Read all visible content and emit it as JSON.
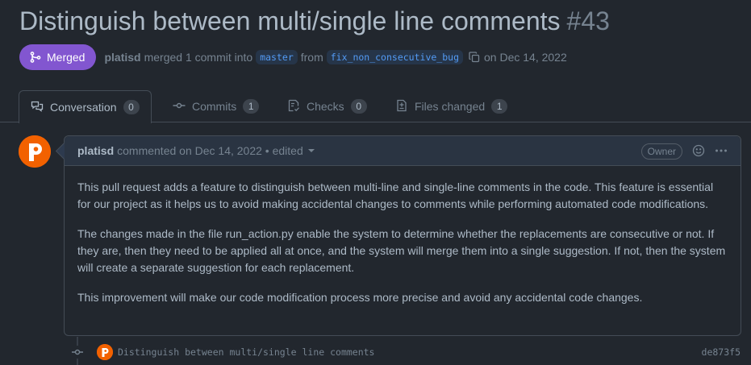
{
  "pr": {
    "title": "Distinguish between multi/single line comments",
    "number": "#43",
    "state_label": "Merged",
    "author": "platisd",
    "merge_text_1": "merged 1 commit into",
    "base_branch": "master",
    "merge_text_2": "from",
    "head_branch": "fix_non_consecutive_bug",
    "merge_text_3": "on Dec 14, 2022"
  },
  "tabs": [
    {
      "label": "Conversation",
      "count": "0",
      "icon": "comment-discussion-icon"
    },
    {
      "label": "Commits",
      "count": "1",
      "icon": "git-commit-icon"
    },
    {
      "label": "Checks",
      "count": "0",
      "icon": "checklist-icon"
    },
    {
      "label": "Files changed",
      "count": "1",
      "icon": "file-diff-icon"
    }
  ],
  "comment": {
    "author": "platisd",
    "meta": "commented on Dec 14, 2022 • edited",
    "badge": "Owner",
    "paragraphs": [
      "This pull request adds a feature to distinguish between multi-line and single-line comments in the code. This feature is essential for our project as it helps us to avoid making accidental changes to comments while performing automated code modifications.",
      "The changes made in the file run_action.py enable the system to determine whether the replacements are consecutive or not. If they are, then they need to be applied all at once, and the system will merge them into a single suggestion. If not, then the system will create a separate suggestion for each replacement.",
      "This improvement will make our code modification process more precise and avoid any accidental code changes."
    ]
  },
  "commit": {
    "message": "Distinguish between multi/single line comments",
    "sha": "de873f5"
  },
  "colors": {
    "background": "#22272e",
    "merged": "#8256d0",
    "link": "#539bf5",
    "avatar": "#f26100"
  }
}
